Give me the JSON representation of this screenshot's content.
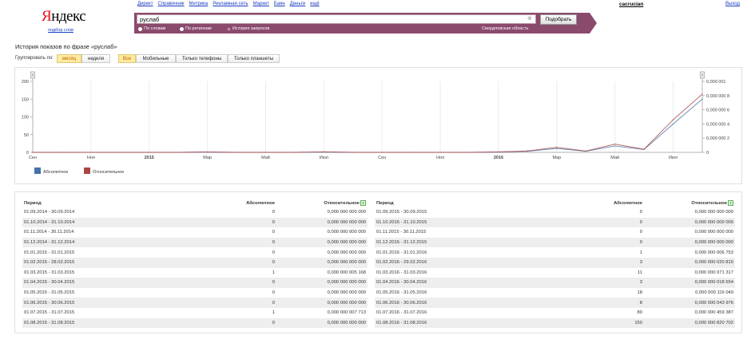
{
  "header": {
    "nav_links": [
      "Директ",
      "Справочник",
      "Метрика",
      "Рекламная сеть",
      "Маркет",
      "Баян",
      "Деньги",
      "ещё"
    ],
    "user": "cacrucian",
    "exit_label": "Выход",
    "logo": "Яндекс",
    "logo_sub": "подбор слов"
  },
  "search": {
    "query": "руслаб",
    "button_label": "Подобрать",
    "modes": [
      {
        "label": "По словам",
        "selected": false
      },
      {
        "label": "По регионам",
        "selected": false
      },
      {
        "label": "История запросов",
        "selected": true
      }
    ],
    "region": "Свердловская область"
  },
  "history": {
    "title": "История показов по фразе «руслаб»",
    "group_label": "Группировать по:",
    "group_options": [
      {
        "label": "месяц",
        "active": true
      },
      {
        "label": "неделя",
        "active": false
      }
    ],
    "device_options": [
      {
        "label": "Все",
        "active": true
      },
      {
        "label": "Мобильные",
        "active": false
      },
      {
        "label": "Только телефоны",
        "active": false
      },
      {
        "label": "Только планшеты",
        "active": false
      }
    ]
  },
  "colors": {
    "accent": "#8a4a6c",
    "absolute": "#4572a7",
    "relative": "#aa4643",
    "active_tab": "#ffeba0"
  },
  "chart_data": {
    "type": "line",
    "x": [
      "2014-09",
      "2014-10",
      "2014-11",
      "2014-12",
      "2015-01",
      "2015-02",
      "2015-03",
      "2015-04",
      "2015-05",
      "2015-06",
      "2015-07",
      "2015-08",
      "2015-09",
      "2015-10",
      "2015-11",
      "2015-12",
      "2016-01",
      "2016-02",
      "2016-03",
      "2016-04",
      "2016-05",
      "2016-06",
      "2016-07",
      "2016-08"
    ],
    "x_tick_labels": [
      "Сен",
      "Ноя",
      "2015",
      "Мар",
      "Май",
      "Июл",
      "Сен",
      "Ноя",
      "2016",
      "Мар",
      "Май",
      "Июл"
    ],
    "y_left_ticks": [
      "0",
      "50",
      "100",
      "150",
      "200"
    ],
    "y_right_ticks": [
      "0",
      "0,000 000 2",
      "0,000 000 4",
      "0,000 000 6",
      "0,000 000 8",
      "0,000 001"
    ],
    "ylim_left": [
      0,
      200
    ],
    "ylim_right": [
      0,
      1e-06
    ],
    "series": [
      {
        "name": "Абсолютное",
        "axis": "left",
        "values": [
          0,
          0,
          0,
          0,
          0,
          0,
          1,
          0,
          0,
          0,
          1,
          0,
          0,
          0,
          0,
          0,
          1,
          3,
          11,
          3,
          18,
          8,
          80,
          150
        ]
      },
      {
        "name": "Относительное",
        "axis": "right",
        "values": [
          0,
          0,
          0,
          0,
          0,
          0,
          5.168e-09,
          0,
          0,
          0,
          7.713e-09,
          0,
          0,
          0,
          0,
          0,
          6.753e-09,
          2.0815e-08,
          7.1317e-08,
          1.8654e-08,
          1.16049e-07,
          4.3976e-08,
          4.59387e-07,
          8.20702e-07
        ]
      }
    ],
    "legend": "bottom-left",
    "grid": true
  },
  "table": {
    "headers": {
      "period": "Период",
      "absolute": "Абсолютное",
      "relative": "Относительное"
    },
    "left_rows": [
      {
        "period": "01.09.2014 - 30.09.2014",
        "absolute": "0",
        "relative": "0,000 000 000 000"
      },
      {
        "period": "01.10.2014 - 31.10.2014",
        "absolute": "0",
        "relative": "0,000 000 000 000"
      },
      {
        "period": "01.11.2014 - 30.11.2014",
        "absolute": "0",
        "relative": "0,000 000 000 000"
      },
      {
        "period": "01.12.2014 - 31.12.2014",
        "absolute": "0",
        "relative": "0,000 000 000 000"
      },
      {
        "period": "01.01.2015 - 31.01.2015",
        "absolute": "0",
        "relative": "0,000 000 000 000"
      },
      {
        "period": "01.02.2015 - 28.02.2015",
        "absolute": "0",
        "relative": "0,000 000 000 000"
      },
      {
        "period": "01.03.2015 - 31.03.2015",
        "absolute": "1",
        "relative": "0,000 000 005 168"
      },
      {
        "period": "01.04.2015 - 30.04.2015",
        "absolute": "0",
        "relative": "0,000 000 000 000"
      },
      {
        "period": "01.05.2015 - 31.05.2015",
        "absolute": "0",
        "relative": "0,000 000 000 000"
      },
      {
        "period": "01.06.2015 - 30.06.2015",
        "absolute": "0",
        "relative": "0,000 000 000 000"
      },
      {
        "period": "01.07.2015 - 31.07.2015",
        "absolute": "1",
        "relative": "0,000 000 007 713"
      },
      {
        "period": "01.08.2015 - 31.08.2015",
        "absolute": "0",
        "relative": "0,000 000 000 000"
      }
    ],
    "right_rows": [
      {
        "period": "01.09.2015 - 30.09.2015",
        "absolute": "0",
        "relative": "0,000 000 000 000"
      },
      {
        "period": "01.10.2015 - 31.10.2015",
        "absolute": "0",
        "relative": "0,000 000 000 000"
      },
      {
        "period": "01.11.2015 - 30.11.2015",
        "absolute": "0",
        "relative": "0,000 000 000 000"
      },
      {
        "period": "01.12.2015 - 31.12.2015",
        "absolute": "0",
        "relative": "0,000 000 000 000"
      },
      {
        "period": "01.01.2016 - 31.01.2016",
        "absolute": "1",
        "relative": "0,000 000 006 753"
      },
      {
        "period": "01.02.2016 - 29.02.2016",
        "absolute": "3",
        "relative": "0,000 000 020 815"
      },
      {
        "period": "01.03.2016 - 31.03.2016",
        "absolute": "11",
        "relative": "0,000 000 071 317"
      },
      {
        "period": "01.04.2016 - 30.04.2016",
        "absolute": "3",
        "relative": "0,000 000 018 654"
      },
      {
        "period": "01.05.2016 - 31.05.2016",
        "absolute": "18",
        "relative": "0,000 000 116 049"
      },
      {
        "period": "01.06.2016 - 30.06.2016",
        "absolute": "8",
        "relative": "0,000 000 043 976"
      },
      {
        "period": "01.07.2016 - 31.07.2016",
        "absolute": "80",
        "relative": "0,000 000 459 387"
      },
      {
        "period": "01.08.2016 - 31.08.2016",
        "absolute": "150",
        "relative": "0,000 000 820 702"
      }
    ]
  }
}
